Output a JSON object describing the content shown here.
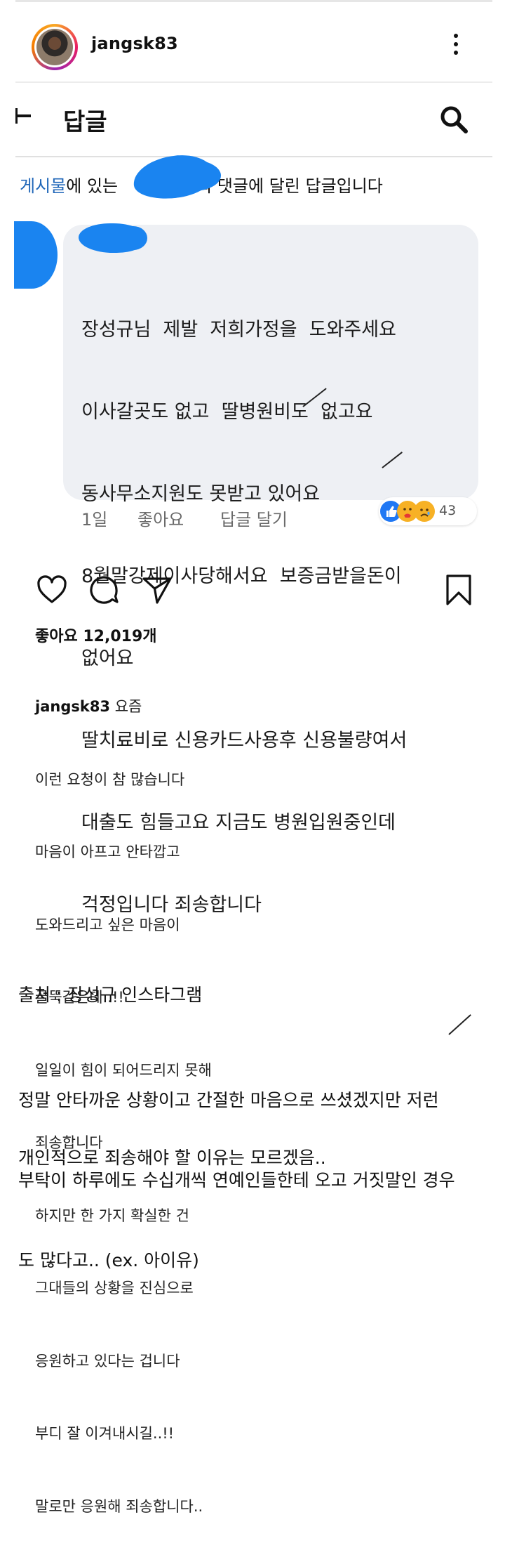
{
  "post": {
    "username": "jangsk83"
  },
  "replies_header": {
    "title": "답글"
  },
  "notice": {
    "link_text": "게시물",
    "text_before": "에 있는",
    "text_after": "의 댓글에 달린 답글입니다"
  },
  "comment": {
    "lines": [
      "장성규님  제발  저희가정을  도와주세요",
      "이사갈곳도 없고  딸병원비도  없고요",
      "동사무소지원도 못받고 있어요",
      "8월말강제이사당해서요  보증금받을돈이",
      "없어요",
      "딸치료비로 신용카드사용후 신용불량여서",
      "대출도 힘들고요 지금도 병원입원중인데",
      "걱정입니다 죄송합니다"
    ],
    "time": "1일",
    "like_label": "좋아요",
    "reply_label": "답글 달기",
    "reaction_count": "43",
    "reaction_icons": [
      "like-icon",
      "care-icon",
      "sad-icon"
    ]
  },
  "actions": {
    "icons": [
      "heart-icon",
      "comment-icon",
      "share-icon",
      "bookmark-icon"
    ]
  },
  "caption": {
    "likes": "좋아요 12,019개",
    "username": "jangsk83",
    "first_line": " 요즘",
    "lines": [
      "이런 요청이 참 많습니다",
      "마음이 아프고 안타깝고",
      "도와드리고 싶은 마음이",
      "굴뚝같은데..!!",
      "일일이 힘이 되어드리지 못해",
      "죄송합니다",
      "하지만 한 가지 확실한 건",
      "그대들의 상황을 진심으로",
      "응원하고 있다는 겁니다",
      "부디 잘 이겨내시길..!!",
      "말로만 응원해 죄송합니다.."
    ]
  },
  "footer": {
    "source": "출처 : 장성규 인스타그램",
    "paragraph": [
      "정말 안타까운 상황이고 간절한 마음으로 쓰셨겠지만 저런",
      "부탁이 하루에도 수십개씩 연예인들한테 오고 거짓말인 경우",
      "도 많다고.. (ex. 아이유)"
    ],
    "closing": "개인적으로 죄송해야 할 이유는 모르겠음.."
  }
}
